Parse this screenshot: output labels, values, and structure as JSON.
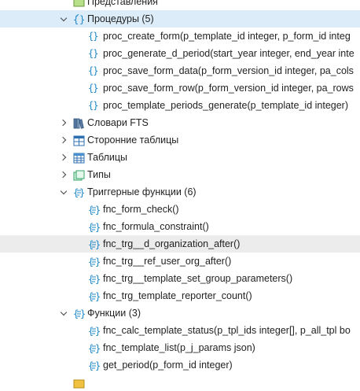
{
  "colors": {
    "selected_bg": "#dcecf9",
    "hover_bg": "#ececec",
    "icon_blue": "#1e88c8",
    "table_green": "#67b04a"
  },
  "top_partial_label": "Представления",
  "procedures": {
    "label": "Процедуры (5)",
    "expanded": true,
    "items": [
      "proc_create_form(p_template_id integer, p_form_id integ",
      "proc_generate_d_period(start_year integer, end_year inte",
      "proc_save_form_data(p_form_version_id integer, pa_cols",
      "proc_save_form_row(p_form_version_id integer, pa_rows",
      "proc_template_periods_generate(p_template_id integer)"
    ]
  },
  "fts_dicts": {
    "label": "Словари FTS",
    "icon": "books-icon"
  },
  "foreign_tables": {
    "label": "Сторонние таблицы",
    "icon": "foreign-table-icon"
  },
  "tables": {
    "label": "Таблицы",
    "icon": "table-icon"
  },
  "types": {
    "label": "Типы",
    "icon": "type-icon"
  },
  "trigger_functions": {
    "label": "Триггерные функции (6)",
    "expanded": true,
    "items": [
      "fnc_form_check()",
      "fnc_formula_constraint()",
      "fnc_trg__d_organization_after()",
      "fnc_trg__ref_user_org_after()",
      "fnc_trg__template_set_group_parameters()",
      "fnc_trg_template_reporter_count()"
    ]
  },
  "functions": {
    "label": "Функции (3)",
    "expanded": true,
    "items": [
      "fnc_calc_template_status(p_tpl_ids integer[], p_all_tpl bo",
      "fnc_template_list(p_j_params json)",
      "get_period(p_form_id integer)"
    ]
  }
}
